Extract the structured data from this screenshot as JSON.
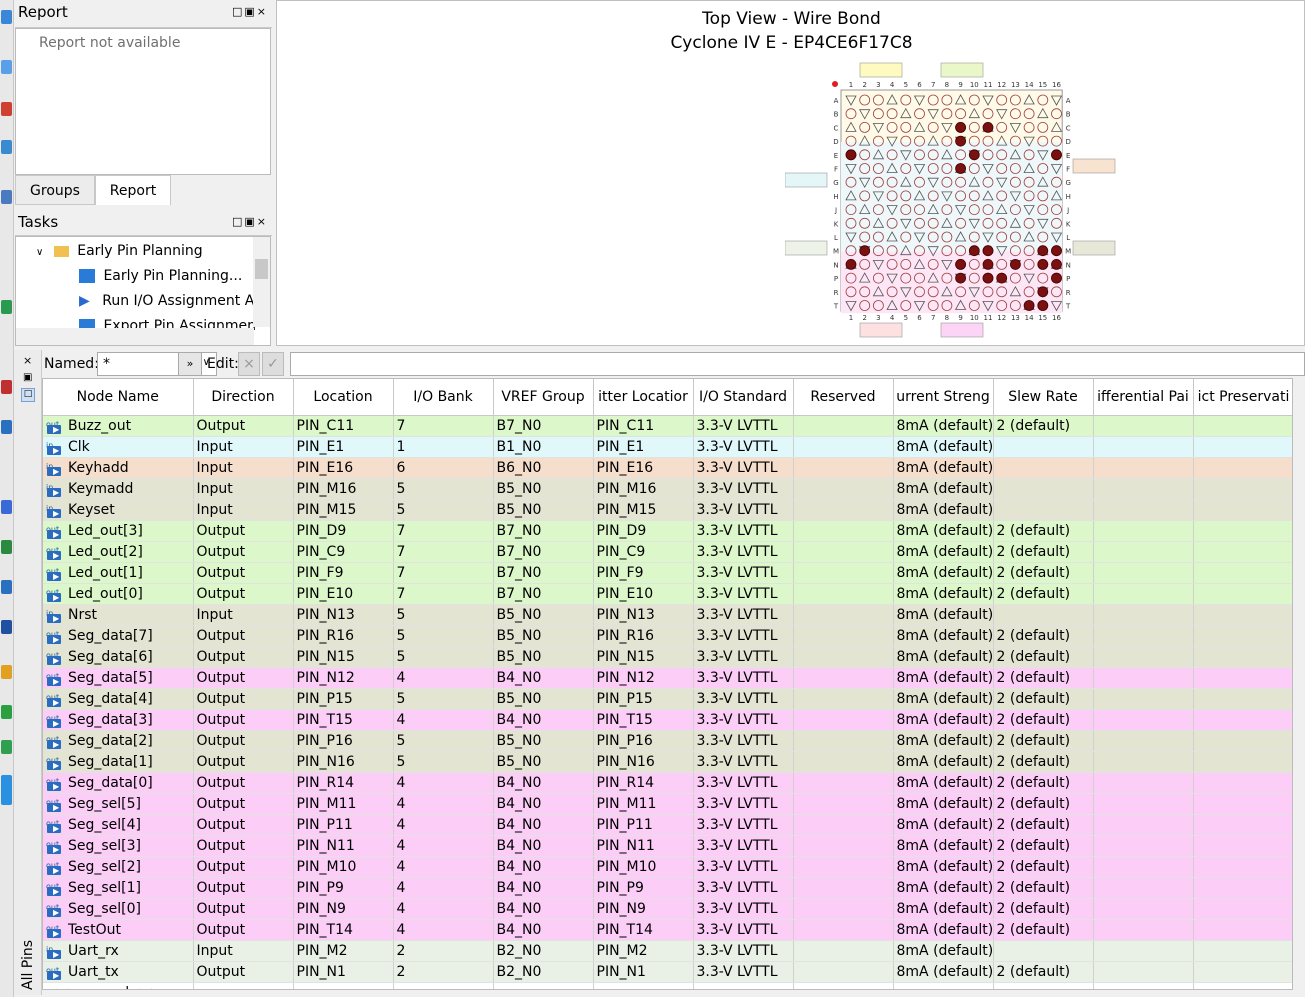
{
  "report_panel": {
    "title": "Report",
    "message": "Report not available",
    "tabs": [
      "Groups",
      "Report"
    ]
  },
  "tasks_panel": {
    "title": "Tasks",
    "items": [
      {
        "label": "Early Pin Planning",
        "level": 0
      },
      {
        "label": "Early Pin Planning...",
        "level": 1
      },
      {
        "label": "Run I/O Assignment A",
        "level": 1
      },
      {
        "label": "Export Pin Assignmen",
        "level": 1
      }
    ]
  },
  "package_view": {
    "title": "Top View - Wire Bond",
    "subtitle": "Cyclone IV E - EP4CE6F17C8",
    "columns": [
      "1",
      "2",
      "3",
      "4",
      "5",
      "6",
      "7",
      "8",
      "9",
      "10",
      "11",
      "12",
      "13",
      "14",
      "15",
      "16"
    ],
    "rows": [
      "A",
      "B",
      "C",
      "D",
      "E",
      "F",
      "G",
      "H",
      "J",
      "K",
      "L",
      "M",
      "N",
      "P",
      "R",
      "T"
    ]
  },
  "filter_bar": {
    "named_label": "Named:",
    "named_value": "*",
    "edit_label": "Edit:",
    "edit_value": ""
  },
  "side_tab": "All Pins",
  "pin_table": {
    "columns": [
      "Node Name",
      "Direction",
      "Location",
      "I/O Bank",
      "VREF Group",
      "Fitter Location",
      "I/O Standard",
      "Reserved",
      "Current Strength",
      "Slew Rate",
      "Differential Pair",
      "Strict Preservation"
    ],
    "column_headers_visible": [
      "Node Name",
      "Direction",
      "Location",
      "I/O Bank",
      "VREF Group",
      "itter Locatior",
      "I/O Standard",
      "Reserved",
      "urrent Streng",
      "Slew Rate",
      "ifferential Pai",
      "ict Preservati"
    ],
    "rows": [
      {
        "name": "Buzz_out",
        "dir": "Output",
        "loc": "PIN_C11",
        "bank": "7",
        "vref": "B7_N0",
        "fitter": "PIN_C11",
        "std": "3.3-V LVTTL",
        "res": "",
        "cur": "8mA (default)",
        "slew": "2 (default)",
        "color": "#dcf7c9"
      },
      {
        "name": "Clk",
        "dir": "Input",
        "loc": "PIN_E1",
        "bank": "1",
        "vref": "B1_N0",
        "fitter": "PIN_E1",
        "std": "3.3-V LVTTL",
        "res": "",
        "cur": "8mA (default)",
        "slew": "",
        "color": "#e0f8fa"
      },
      {
        "name": "Keyhadd",
        "dir": "Input",
        "loc": "PIN_E16",
        "bank": "6",
        "vref": "B6_N0",
        "fitter": "PIN_E16",
        "std": "3.3-V LVTTL",
        "res": "",
        "cur": "8mA (default)",
        "slew": "",
        "color": "#f5decb"
      },
      {
        "name": "Keymadd",
        "dir": "Input",
        "loc": "PIN_M16",
        "bank": "5",
        "vref": "B5_N0",
        "fitter": "PIN_M16",
        "std": "3.3-V LVTTL",
        "res": "",
        "cur": "8mA (default)",
        "slew": "",
        "color": "#e4e4d2"
      },
      {
        "name": "Keyset",
        "dir": "Input",
        "loc": "PIN_M15",
        "bank": "5",
        "vref": "B5_N0",
        "fitter": "PIN_M15",
        "std": "3.3-V LVTTL",
        "res": "",
        "cur": "8mA (default)",
        "slew": "",
        "color": "#e4e4d2"
      },
      {
        "name": "Led_out[3]",
        "dir": "Output",
        "loc": "PIN_D9",
        "bank": "7",
        "vref": "B7_N0",
        "fitter": "PIN_D9",
        "std": "3.3-V LVTTL",
        "res": "",
        "cur": "8mA (default)",
        "slew": "2 (default)",
        "color": "#dcf7c9"
      },
      {
        "name": "Led_out[2]",
        "dir": "Output",
        "loc": "PIN_C9",
        "bank": "7",
        "vref": "B7_N0",
        "fitter": "PIN_C9",
        "std": "3.3-V LVTTL",
        "res": "",
        "cur": "8mA (default)",
        "slew": "2 (default)",
        "color": "#dcf7c9"
      },
      {
        "name": "Led_out[1]",
        "dir": "Output",
        "loc": "PIN_F9",
        "bank": "7",
        "vref": "B7_N0",
        "fitter": "PIN_F9",
        "std": "3.3-V LVTTL",
        "res": "",
        "cur": "8mA (default)",
        "slew": "2 (default)",
        "color": "#dcf7c9"
      },
      {
        "name": "Led_out[0]",
        "dir": "Output",
        "loc": "PIN_E10",
        "bank": "7",
        "vref": "B7_N0",
        "fitter": "PIN_E10",
        "std": "3.3-V LVTTL",
        "res": "",
        "cur": "8mA (default)",
        "slew": "2 (default)",
        "color": "#dcf7c9"
      },
      {
        "name": "Nrst",
        "dir": "Input",
        "loc": "PIN_N13",
        "bank": "5",
        "vref": "B5_N0",
        "fitter": "PIN_N13",
        "std": "3.3-V LVTTL",
        "res": "",
        "cur": "8mA (default)",
        "slew": "",
        "color": "#e4e4d2"
      },
      {
        "name": "Seg_data[7]",
        "dir": "Output",
        "loc": "PIN_R16",
        "bank": "5",
        "vref": "B5_N0",
        "fitter": "PIN_R16",
        "std": "3.3-V LVTTL",
        "res": "",
        "cur": "8mA (default)",
        "slew": "2 (default)",
        "color": "#e4e4d2"
      },
      {
        "name": "Seg_data[6]",
        "dir": "Output",
        "loc": "PIN_N15",
        "bank": "5",
        "vref": "B5_N0",
        "fitter": "PIN_N15",
        "std": "3.3-V LVTTL",
        "res": "",
        "cur": "8mA (default)",
        "slew": "2 (default)",
        "color": "#e4e4d2"
      },
      {
        "name": "Seg_data[5]",
        "dir": "Output",
        "loc": "PIN_N12",
        "bank": "4",
        "vref": "B4_N0",
        "fitter": "PIN_N12",
        "std": "3.3-V LVTTL",
        "res": "",
        "cur": "8mA (default)",
        "slew": "2 (default)",
        "color": "#fccdf7"
      },
      {
        "name": "Seg_data[4]",
        "dir": "Output",
        "loc": "PIN_P15",
        "bank": "5",
        "vref": "B5_N0",
        "fitter": "PIN_P15",
        "std": "3.3-V LVTTL",
        "res": "",
        "cur": "8mA (default)",
        "slew": "2 (default)",
        "color": "#e4e4d2"
      },
      {
        "name": "Seg_data[3]",
        "dir": "Output",
        "loc": "PIN_T15",
        "bank": "4",
        "vref": "B4_N0",
        "fitter": "PIN_T15",
        "std": "3.3-V LVTTL",
        "res": "",
        "cur": "8mA (default)",
        "slew": "2 (default)",
        "color": "#fccdf7"
      },
      {
        "name": "Seg_data[2]",
        "dir": "Output",
        "loc": "PIN_P16",
        "bank": "5",
        "vref": "B5_N0",
        "fitter": "PIN_P16",
        "std": "3.3-V LVTTL",
        "res": "",
        "cur": "8mA (default)",
        "slew": "2 (default)",
        "color": "#e4e4d2"
      },
      {
        "name": "Seg_data[1]",
        "dir": "Output",
        "loc": "PIN_N16",
        "bank": "5",
        "vref": "B5_N0",
        "fitter": "PIN_N16",
        "std": "3.3-V LVTTL",
        "res": "",
        "cur": "8mA (default)",
        "slew": "2 (default)",
        "color": "#e4e4d2"
      },
      {
        "name": "Seg_data[0]",
        "dir": "Output",
        "loc": "PIN_R14",
        "bank": "4",
        "vref": "B4_N0",
        "fitter": "PIN_R14",
        "std": "3.3-V LVTTL",
        "res": "",
        "cur": "8mA (default)",
        "slew": "2 (default)",
        "color": "#fccdf7"
      },
      {
        "name": "Seg_sel[5]",
        "dir": "Output",
        "loc": "PIN_M11",
        "bank": "4",
        "vref": "B4_N0",
        "fitter": "PIN_M11",
        "std": "3.3-V LVTTL",
        "res": "",
        "cur": "8mA (default)",
        "slew": "2 (default)",
        "color": "#fccdf7"
      },
      {
        "name": "Seg_sel[4]",
        "dir": "Output",
        "loc": "PIN_P11",
        "bank": "4",
        "vref": "B4_N0",
        "fitter": "PIN_P11",
        "std": "3.3-V LVTTL",
        "res": "",
        "cur": "8mA (default)",
        "slew": "2 (default)",
        "color": "#fccdf7"
      },
      {
        "name": "Seg_sel[3]",
        "dir": "Output",
        "loc": "PIN_N11",
        "bank": "4",
        "vref": "B4_N0",
        "fitter": "PIN_N11",
        "std": "3.3-V LVTTL",
        "res": "",
        "cur": "8mA (default)",
        "slew": "2 (default)",
        "color": "#fccdf7"
      },
      {
        "name": "Seg_sel[2]",
        "dir": "Output",
        "loc": "PIN_M10",
        "bank": "4",
        "vref": "B4_N0",
        "fitter": "PIN_M10",
        "std": "3.3-V LVTTL",
        "res": "",
        "cur": "8mA (default)",
        "slew": "2 (default)",
        "color": "#fccdf7"
      },
      {
        "name": "Seg_sel[1]",
        "dir": "Output",
        "loc": "PIN_P9",
        "bank": "4",
        "vref": "B4_N0",
        "fitter": "PIN_P9",
        "std": "3.3-V LVTTL",
        "res": "",
        "cur": "8mA (default)",
        "slew": "2 (default)",
        "color": "#fccdf7"
      },
      {
        "name": "Seg_sel[0]",
        "dir": "Output",
        "loc": "PIN_N9",
        "bank": "4",
        "vref": "B4_N0",
        "fitter": "PIN_N9",
        "std": "3.3-V LVTTL",
        "res": "",
        "cur": "8mA (default)",
        "slew": "2 (default)",
        "color": "#fccdf7"
      },
      {
        "name": "TestOut",
        "dir": "Output",
        "loc": "PIN_T14",
        "bank": "4",
        "vref": "B4_N0",
        "fitter": "PIN_T14",
        "std": "3.3-V LVTTL",
        "res": "",
        "cur": "8mA (default)",
        "slew": "2 (default)",
        "color": "#fccdf7"
      },
      {
        "name": "Uart_rx",
        "dir": "Input",
        "loc": "PIN_M2",
        "bank": "2",
        "vref": "B2_N0",
        "fitter": "PIN_M2",
        "std": "3.3-V LVTTL",
        "res": "",
        "cur": "8mA (default)",
        "slew": "",
        "color": "#e9f1e6"
      },
      {
        "name": "Uart_tx",
        "dir": "Output",
        "loc": "PIN_N1",
        "bank": "2",
        "vref": "B2_N0",
        "fitter": "PIN_N1",
        "std": "3.3-V LVTTL",
        "res": "",
        "cur": "8mA (default)",
        "slew": "2 (default)",
        "color": "#e9f1e6"
      }
    ],
    "new_node_label": "<<new node>>"
  }
}
